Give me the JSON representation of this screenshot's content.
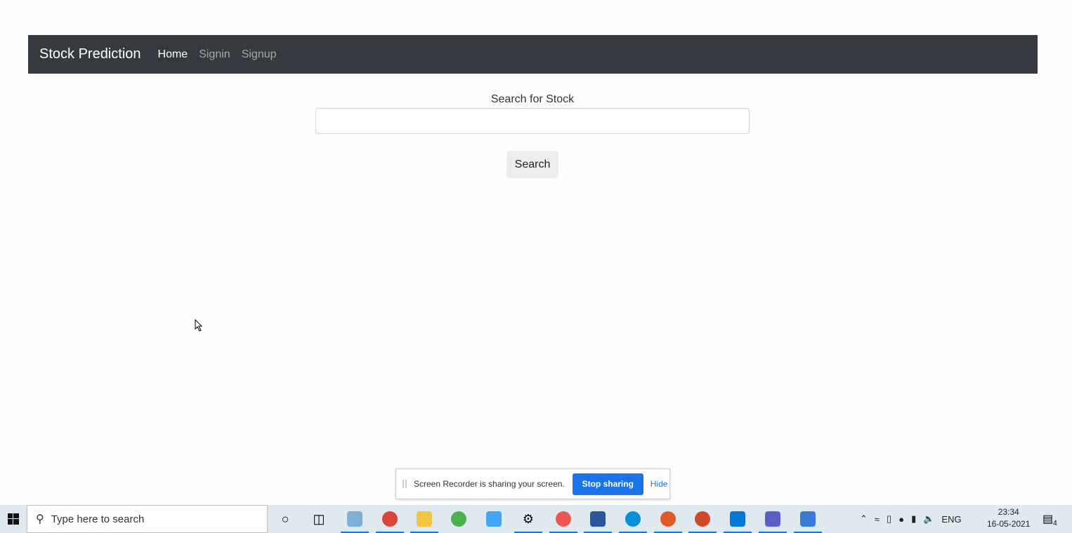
{
  "navbar": {
    "brand": "Stock Prediction",
    "links": [
      "Home",
      "Signin",
      "Signup"
    ]
  },
  "form": {
    "label": "Search for Stock",
    "value": "",
    "button": "Search"
  },
  "share_bar": {
    "message": "Screen Recorder is sharing your screen.",
    "stop": "Stop sharing",
    "hide": "Hide"
  },
  "taskbar": {
    "search_placeholder": "Type here to search",
    "language": "ENG",
    "time": "23:34",
    "date": "16-05-2021",
    "notifications": "4",
    "apps": [
      {
        "name": "cortana",
        "color": "#222"
      },
      {
        "name": "task-view",
        "color": "#222"
      },
      {
        "name": "notepad",
        "color": "#7fb0d8"
      },
      {
        "name": "chrome",
        "color": "#db4437"
      },
      {
        "name": "file-explorer",
        "color": "#f4c542"
      },
      {
        "name": "app-globe",
        "color": "#4caf50"
      },
      {
        "name": "app-blue",
        "color": "#42a5f5"
      },
      {
        "name": "settings",
        "color": "#333"
      },
      {
        "name": "snipping",
        "color": "#e55"
      },
      {
        "name": "word",
        "color": "#2b579a"
      },
      {
        "name": "edge",
        "color": "#0c8ed9"
      },
      {
        "name": "chrome-profile",
        "color": "#e0592a"
      },
      {
        "name": "powerpoint",
        "color": "#d24726"
      },
      {
        "name": "vscode",
        "color": "#0078d4"
      },
      {
        "name": "teams",
        "color": "#5b5fc7"
      },
      {
        "name": "remote",
        "color": "#3a7bd5"
      }
    ]
  }
}
